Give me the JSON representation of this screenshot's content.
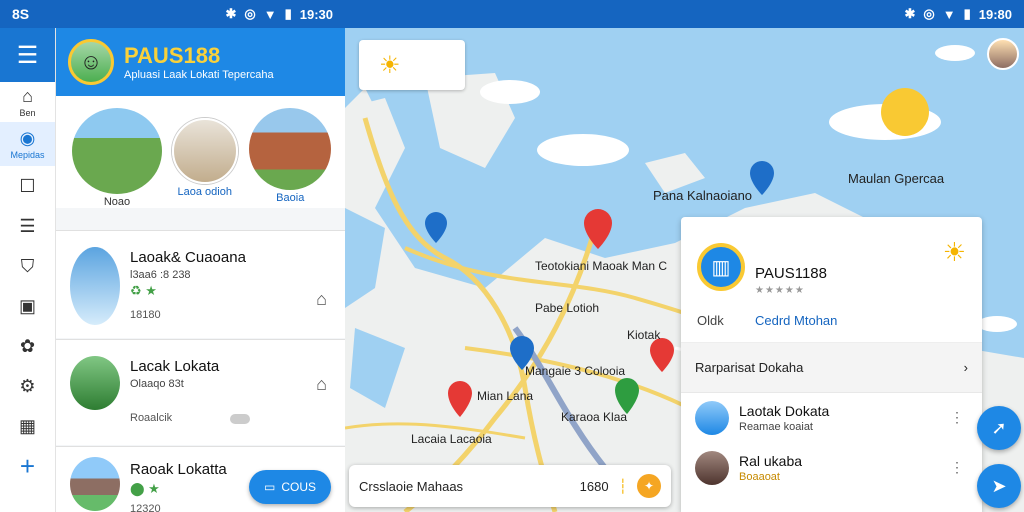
{
  "status": {
    "left_label": "8S",
    "left_time": "19:30",
    "right_time": "19:80"
  },
  "rail": {
    "items": [
      {
        "label": "Ben",
        "icon": "home-outline-icon"
      },
      {
        "label": "Mepidas",
        "icon": "compass-icon"
      },
      {
        "label": "",
        "icon": "square-icon"
      },
      {
        "label": "",
        "icon": "list-icon"
      },
      {
        "label": "",
        "icon": "shield-icon"
      },
      {
        "label": "",
        "icon": "image-icon"
      },
      {
        "label": "",
        "icon": "palette-icon"
      },
      {
        "label": "",
        "icon": "gear-icon"
      },
      {
        "label": "",
        "icon": "calendar-icon"
      }
    ]
  },
  "panel": {
    "brand_title": "PAUS188",
    "brand_subtitle": "Apluasi Laak Lokati Tepercaha",
    "circles": [
      {
        "label": "Noao"
      },
      {
        "label": "Laoa odioh"
      },
      {
        "label": "Baoia"
      }
    ],
    "cards": [
      {
        "title": "Laoak& Cuaoana",
        "sub": "l3aa6 :8 238",
        "meta": "18180"
      },
      {
        "title": "Lacak Lokata",
        "sub": "Olaaqo 83t",
        "meta": "Roaalcik"
      },
      {
        "title": "Raoak Lokatta",
        "sub": "",
        "meta": "12320"
      }
    ],
    "fab_label": "COUS"
  },
  "map": {
    "labels": {
      "pana": "Pana Kalnaoiano",
      "maulan": "Maulan Gpercaa",
      "teotokian": "Teotokiani Maoak Man C",
      "pabe": "Pabe Lotioh",
      "kiotak": "Kiotak",
      "mangaie": "Mangaie 3 Colooia",
      "mian": "Mian Lana",
      "karaoa": "Karaoa Klaa",
      "lacaia": "Lacaia Lacaoia"
    },
    "search": {
      "text": "Crsslaoie Mahaas",
      "value": "1680"
    }
  },
  "info": {
    "title": "PAUS1188",
    "left": "Oldk",
    "right": "Cedrd Mtohan",
    "row_label": "Rarparisat Dokaha",
    "items": [
      {
        "title": "Laotak Dokata",
        "sub": "Reamae koaiat"
      },
      {
        "title": "Ral ukaba",
        "sub": "Boaaoat"
      }
    ]
  },
  "colors": {
    "primary": "#1e88e5",
    "status_bar": "#1565c0",
    "brand_yellow": "#f9d13b",
    "water": "#9fd0f2",
    "land": "#eef0ef",
    "road": "#f3d36b"
  }
}
